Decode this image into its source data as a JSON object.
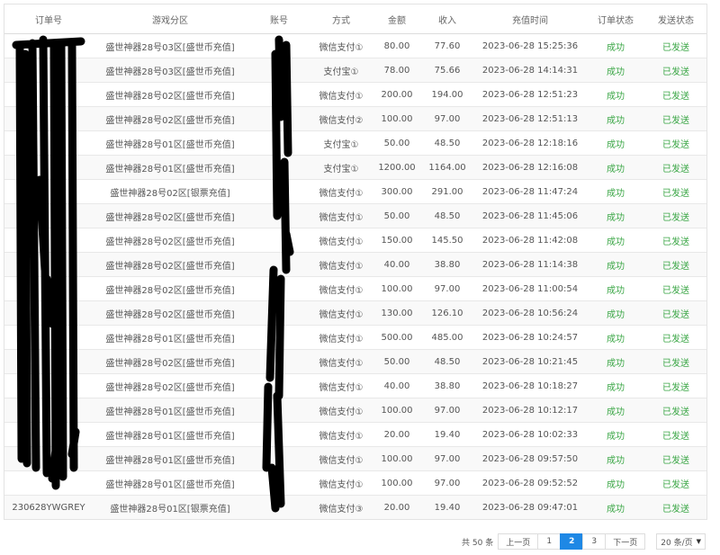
{
  "columns": [
    "订单号",
    "游戏分区",
    "账号",
    "方式",
    "金额",
    "收入",
    "充值时间",
    "订单状态",
    "发送状态"
  ],
  "rows": [
    [
      "",
      "盛世神器28号03区[盛世币充值]",
      "",
      "微信支付①",
      "80.00",
      "77.60",
      "2023-06-28 15:25:36",
      "成功",
      "已发送"
    ],
    [
      "",
      "盛世神器28号03区[盛世币充值]",
      "",
      "支付宝①",
      "78.00",
      "75.66",
      "2023-06-28 14:14:31",
      "成功",
      "已发送"
    ],
    [
      "",
      "盛世神器28号02区[盛世币充值]",
      "",
      "微信支付①",
      "200.00",
      "194.00",
      "2023-06-28 12:51:23",
      "成功",
      "已发送"
    ],
    [
      "",
      "盛世神器28号02区[盛世币充值]",
      "",
      "微信支付②",
      "100.00",
      "97.00",
      "2023-06-28 12:51:13",
      "成功",
      "已发送"
    ],
    [
      "",
      "盛世神器28号01区[盛世币充值]",
      "",
      "支付宝①",
      "50.00",
      "48.50",
      "2023-06-28 12:18:16",
      "成功",
      "已发送"
    ],
    [
      "",
      "盛世神器28号01区[盛世币充值]",
      "",
      "支付宝①",
      "1200.00",
      "1164.00",
      "2023-06-28 12:16:08",
      "成功",
      "已发送"
    ],
    [
      "",
      "盛世神器28号02区[银票充值]",
      "",
      "微信支付①",
      "300.00",
      "291.00",
      "2023-06-28 11:47:24",
      "成功",
      "已发送"
    ],
    [
      "",
      "盛世神器28号02区[盛世币充值]",
      "",
      "微信支付①",
      "50.00",
      "48.50",
      "2023-06-28 11:45:06",
      "成功",
      "已发送"
    ],
    [
      "",
      "盛世神器28号02区[盛世币充值]",
      "",
      "微信支付①",
      "150.00",
      "145.50",
      "2023-06-28 11:42:08",
      "成功",
      "已发送"
    ],
    [
      "",
      "盛世神器28号02区[盛世币充值]",
      "",
      "微信支付①",
      "40.00",
      "38.80",
      "2023-06-28 11:14:38",
      "成功",
      "已发送"
    ],
    [
      "",
      "盛世神器28号02区[盛世币充值]",
      "",
      "微信支付①",
      "100.00",
      "97.00",
      "2023-06-28 11:00:54",
      "成功",
      "已发送"
    ],
    [
      "",
      "盛世神器28号02区[盛世币充值]",
      "",
      "微信支付①",
      "130.00",
      "126.10",
      "2023-06-28 10:56:24",
      "成功",
      "已发送"
    ],
    [
      "",
      "盛世神器28号01区[盛世币充值]",
      "",
      "微信支付①",
      "500.00",
      "485.00",
      "2023-06-28 10:24:57",
      "成功",
      "已发送"
    ],
    [
      "",
      "盛世神器28号02区[盛世币充值]",
      "",
      "微信支付①",
      "50.00",
      "48.50",
      "2023-06-28 10:21:45",
      "成功",
      "已发送"
    ],
    [
      "",
      "盛世神器28号02区[盛世币充值]",
      "",
      "微信支付①",
      "40.00",
      "38.80",
      "2023-06-28 10:18:27",
      "成功",
      "已发送"
    ],
    [
      "",
      "盛世神器28号01区[盛世币充值]",
      "",
      "微信支付①",
      "100.00",
      "97.00",
      "2023-06-28 10:12:17",
      "成功",
      "已发送"
    ],
    [
      "",
      "盛世神器28号01区[盛世币充值]",
      "",
      "微信支付①",
      "20.00",
      "19.40",
      "2023-06-28 10:02:33",
      "成功",
      "已发送"
    ],
    [
      "",
      "盛世神器28号01区[盛世币充值]",
      "",
      "微信支付①",
      "100.00",
      "97.00",
      "2023-06-28 09:57:50",
      "成功",
      "已发送"
    ],
    [
      "",
      "盛世神器28号01区[盛世币充值]",
      "",
      "微信支付①",
      "100.00",
      "97.00",
      "2023-06-28 09:52:52",
      "成功",
      "已发送"
    ],
    [
      "230628YWGREY",
      "盛世神器28号01区[银票充值]",
      "",
      "微信支付③",
      "20.00",
      "19.40",
      "2023-06-28 09:47:01",
      "成功",
      "已发送"
    ]
  ],
  "pagination": {
    "total": "共 50 条",
    "prev": "上一页",
    "pages": [
      "1",
      "2",
      "3"
    ],
    "current": "2",
    "next": "下一页",
    "page_size": "20 条/页",
    "accent": "#1e88e5"
  },
  "status_color": "#3aa645"
}
